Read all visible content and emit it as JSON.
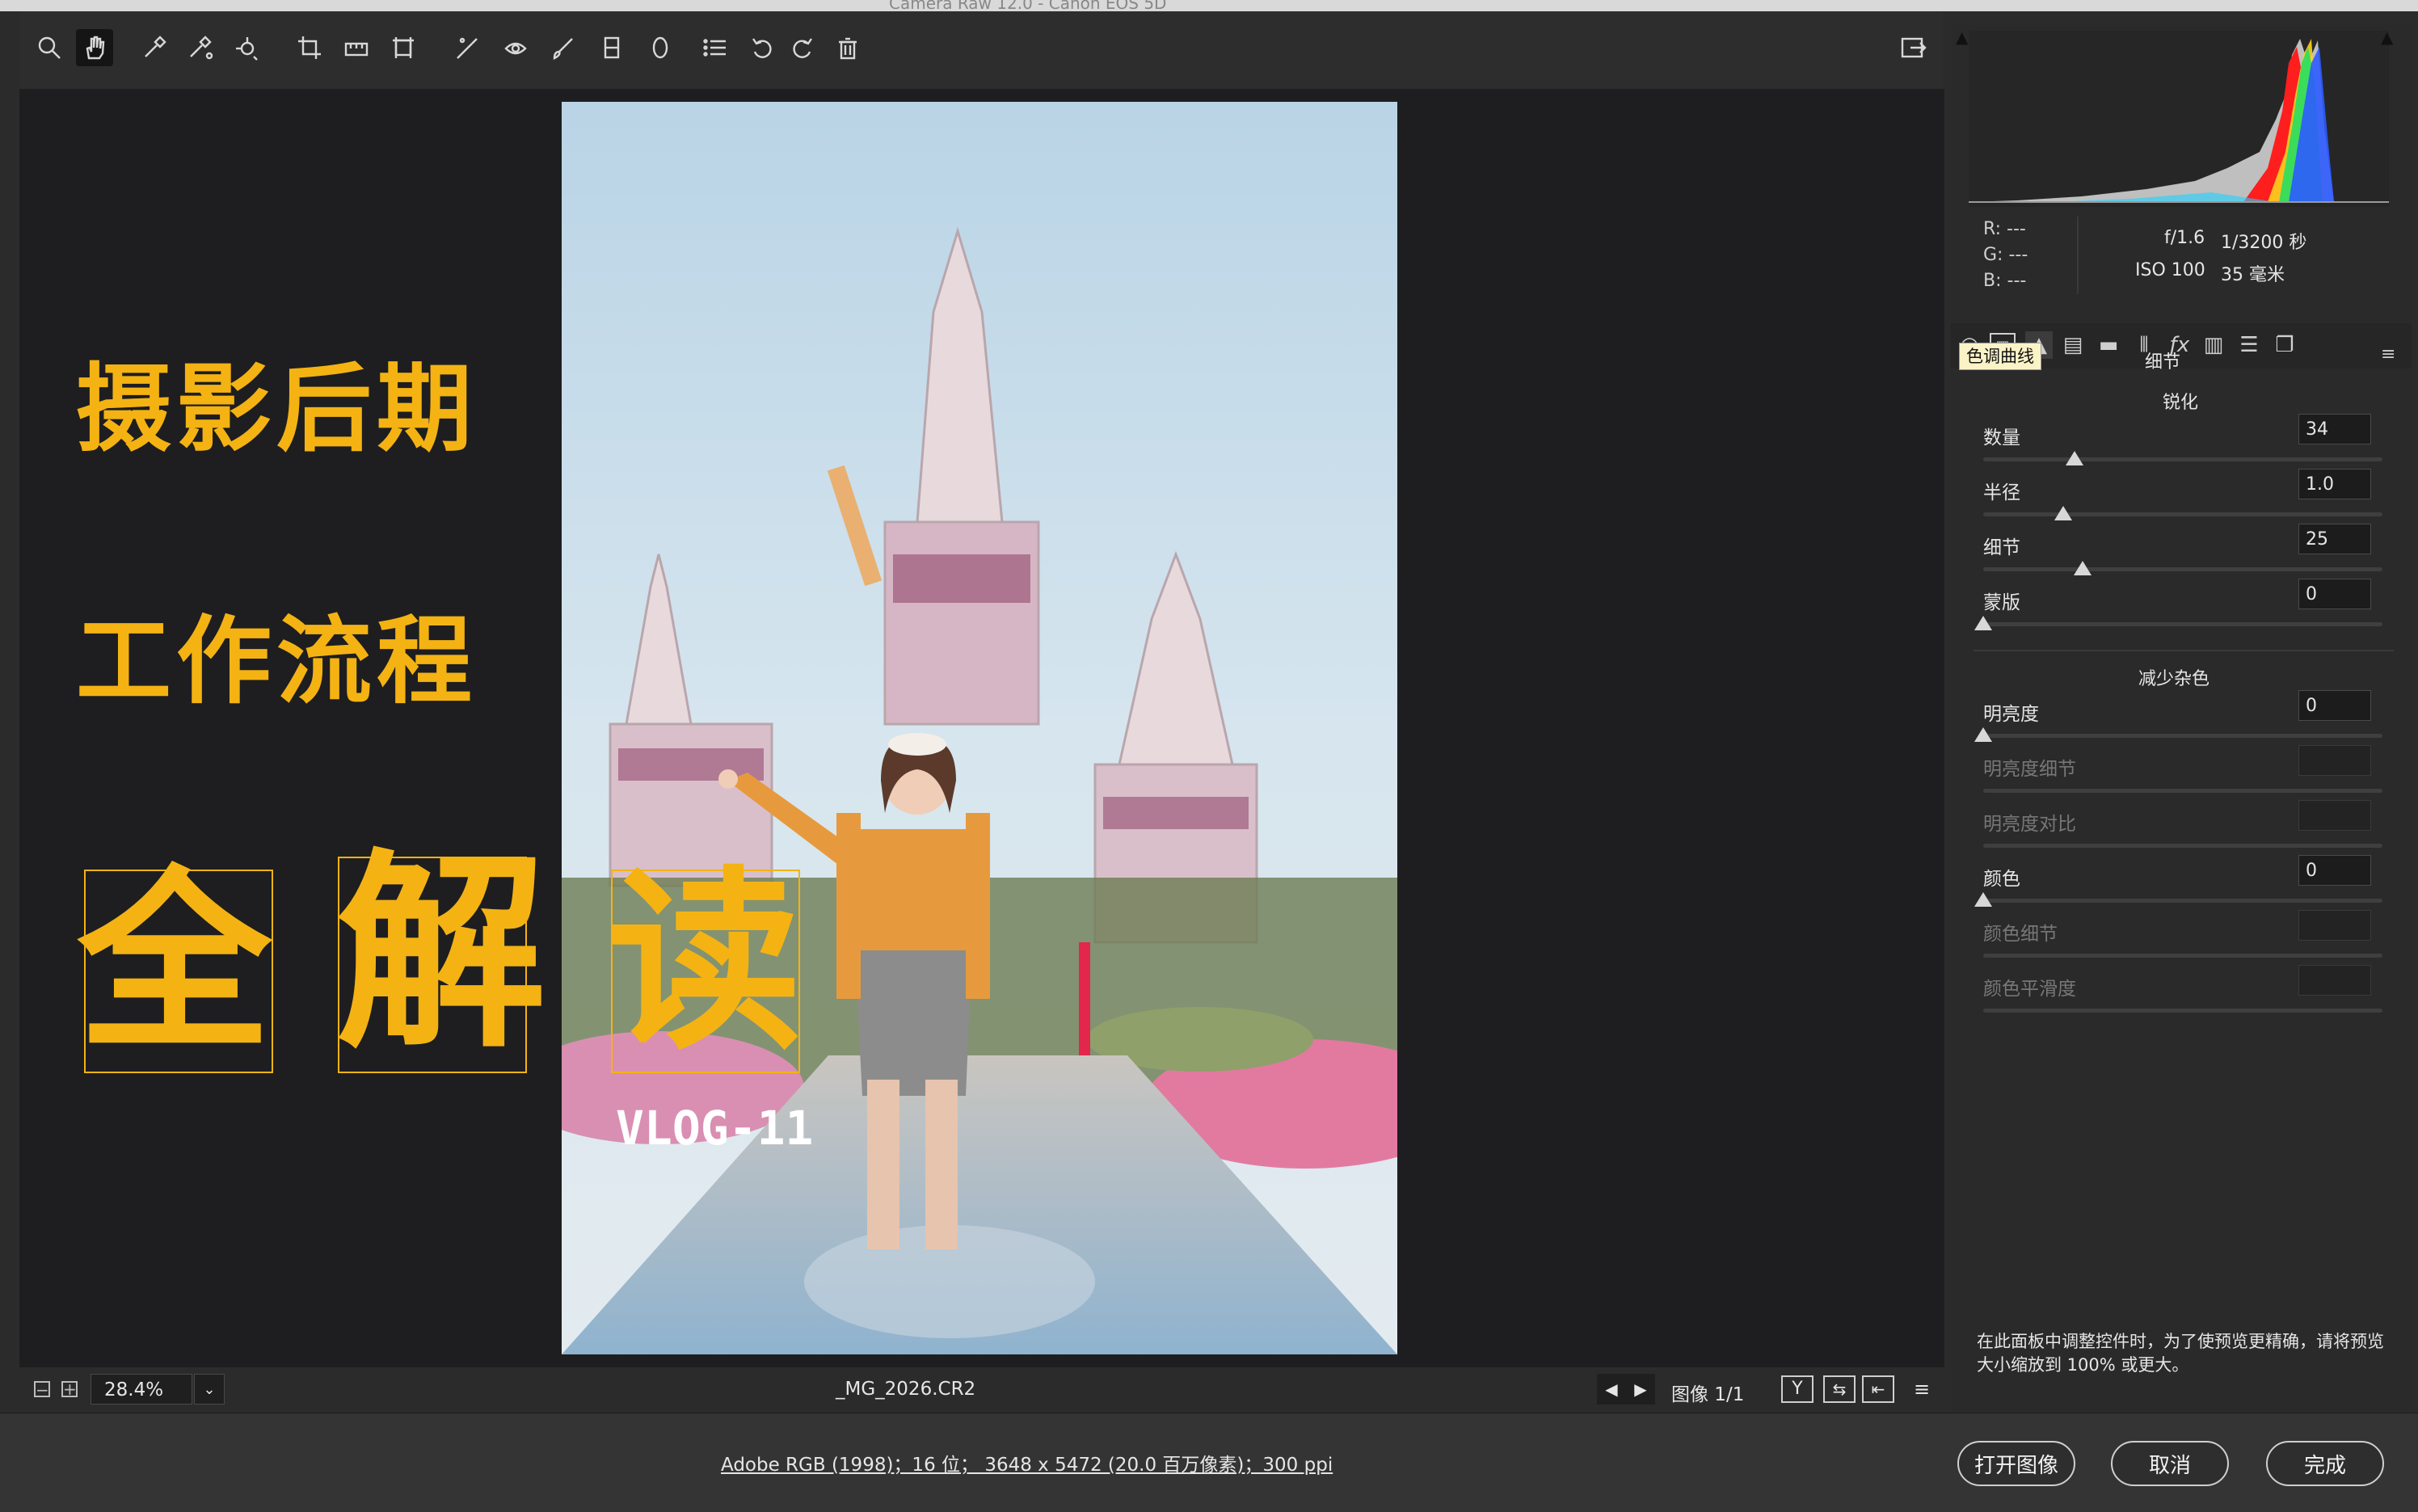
{
  "window_title": "Camera Raw 12.0  -  Canon EOS 5D",
  "toolbar": {
    "tools": [
      "zoom-tool",
      "hand-tool",
      "white-balance-tool",
      "color-sampler-tool",
      "targeted-adjustment-tool",
      "crop-tool",
      "straighten-tool",
      "transform-tool",
      "spot-removal-tool",
      "red-eye-tool",
      "adjustment-brush-tool",
      "graduated-filter-tool",
      "radial-filter-tool",
      "presets-list",
      "rotate-left",
      "rotate-right",
      "delete"
    ]
  },
  "overlay": {
    "line1": "摄影后期",
    "line2": "工作流程",
    "big": [
      "全",
      "解",
      "读"
    ],
    "vlog": "VLOG-11"
  },
  "bottom_bar": {
    "zoom": "28.4%",
    "filename": "_MG_2026.CR2",
    "image_counter": "图像 1/1"
  },
  "footer": {
    "workflow_info": "Adobe RGB (1998)；16 位；  3648 x 5472 (20.0 百万像素)；300 ppi",
    "open_image": "打开图像",
    "cancel": "取消",
    "done": "完成"
  },
  "readout": {
    "r": "R:",
    "g": "G:",
    "b": "B:",
    "r_val": "---",
    "g_val": "---",
    "b_val": "---",
    "aperture": "f/1.6",
    "shutter": "1/3200 秒",
    "iso": "ISO 100",
    "focal": "35 毫米"
  },
  "panel": {
    "tooltip": "色调曲线",
    "title": "细节",
    "sharpen_header": "锐化",
    "noise_header": "减少杂色",
    "sliders": [
      {
        "label": "数量",
        "value": "34",
        "pos": 0.23,
        "enabled": true
      },
      {
        "label": "半径",
        "value": "1.0",
        "pos": 0.2,
        "enabled": true
      },
      {
        "label": "细节",
        "value": "25",
        "pos": 0.25,
        "enabled": true
      },
      {
        "label": "蒙版",
        "value": "0",
        "pos": 0.0,
        "enabled": true
      }
    ],
    "noise_sliders": [
      {
        "label": "明亮度",
        "value": "0",
        "pos": 0.0,
        "enabled": true
      },
      {
        "label": "明亮度细节",
        "value": "",
        "pos": null,
        "enabled": false
      },
      {
        "label": "明亮度对比",
        "value": "",
        "pos": null,
        "enabled": false
      },
      {
        "label": "颜色",
        "value": "0",
        "pos": 0.0,
        "enabled": true
      },
      {
        "label": "颜色细节",
        "value": "",
        "pos": null,
        "enabled": false
      },
      {
        "label": "颜色平滑度",
        "value": "",
        "pos": null,
        "enabled": false
      }
    ],
    "note": "在此面板中调整控件时，为了使预览更精确，请将预览大小缩放到 100% 或更大。"
  },
  "colors": {
    "accent_yellow": "#f4b313",
    "panel_bg": "#2a2a2a",
    "canvas_bg": "#1e1e20"
  }
}
